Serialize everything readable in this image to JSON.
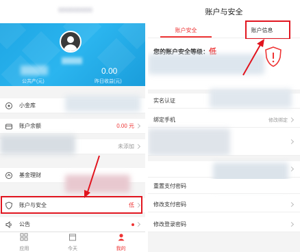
{
  "left": {
    "header": {
      "stat_right_value": "0.00",
      "stat_left_label": "公共产(元)",
      "stat_right_label": "昨日收益(元)"
    },
    "menu": [
      {
        "label": "小金库",
        "icon": "piggy-icon",
        "value": ""
      },
      {
        "label": "账户余额",
        "icon": "wallet-icon",
        "value": "0.00 元"
      },
      {
        "label": "",
        "icon": "",
        "value": "未添加"
      },
      {
        "label": "基金理财",
        "icon": "fund-icon",
        "value": ""
      },
      {
        "label": "账户与安全",
        "icon": "shield-icon",
        "value": "低"
      },
      {
        "label": "公告",
        "icon": "speaker-icon",
        "value": ""
      }
    ],
    "tabbar": [
      {
        "label": "应用",
        "icon": "grid-icon"
      },
      {
        "label": "今天",
        "icon": "calendar-icon"
      },
      {
        "label": "我的",
        "icon": "user-icon"
      }
    ],
    "colors": {
      "accent": "#e33333",
      "header": "#23acea",
      "highlight": "#e1141e"
    }
  },
  "right": {
    "title": "账户与安全",
    "tabs": [
      "账户安全",
      "账户信息"
    ],
    "security_level_label": "您的账户安全等级：",
    "security_level_value": "低",
    "rows": [
      {
        "label": "实名认证",
        "value": ""
      },
      {
        "label": "绑定手机",
        "value": "修改绑定"
      },
      {
        "label": "重置支付密码",
        "value": ""
      },
      {
        "label": "修改支付密码",
        "value": ""
      },
      {
        "label": "修改登录密码",
        "value": ""
      }
    ]
  }
}
